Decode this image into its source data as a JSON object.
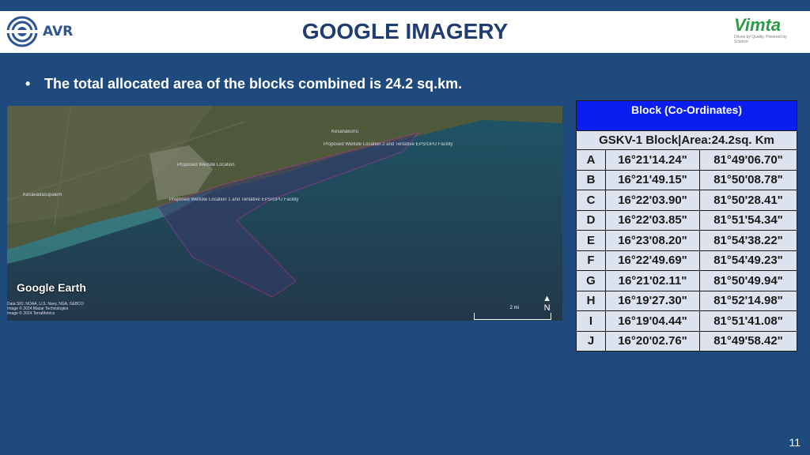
{
  "header": {
    "title": "GOOGLE IMAGERY",
    "left_logo_text": "AVR",
    "right_logo_text": "Vimta",
    "right_logo_tagline": "Drives by Quality, Powered by Science"
  },
  "bullet": {
    "symbol": "•",
    "text": "The total allocated area of the blocks combined is 24.2 sq.km."
  },
  "map": {
    "brand": "Google Earth",
    "scale_label": "2 mi",
    "labels": {
      "location2": "Proposed Wellsite Location 2 and Tentative EPS/GPU Facility",
      "location1": "Proposed Wellsite Location 1 and Tentative EPS/GPU Facility",
      "wellsite": "Proposed Wellsite Location",
      "town1": "Kesavadasupalem",
      "town2": "Kesanakurru"
    },
    "credits": [
      "Data SIO, NOAA, U.S. Navy, NGA, GEBCO",
      "Image © 2024 Maxar Technologies",
      "Image © 2024 TerraMetrics"
    ]
  },
  "table": {
    "header": "Block (Co-Ordinates)",
    "subheader": "GSKV-1 Block|Area:24.2sq. Km",
    "rows": [
      {
        "pt": "A",
        "lat": "16°21'14.24\"",
        "lon": "81°49'06.70\""
      },
      {
        "pt": "B",
        "lat": "16°21'49.15\"",
        "lon": "81°50'08.78\""
      },
      {
        "pt": "C",
        "lat": "16°22'03.90\"",
        "lon": "81°50'28.41\""
      },
      {
        "pt": "D",
        "lat": "16°22'03.85\"",
        "lon": "81°51'54.34\""
      },
      {
        "pt": "E",
        "lat": "16°23'08.20\"",
        "lon": "81°54'38.22\""
      },
      {
        "pt": "F",
        "lat": "16°22'49.69\"",
        "lon": "81°54'49.23\""
      },
      {
        "pt": "G",
        "lat": "16°21'02.11\"",
        "lon": "81°50'49.94\""
      },
      {
        "pt": "H",
        "lat": "16°19'27.30\"",
        "lon": "81°52'14.98\""
      },
      {
        "pt": "I",
        "lat": "16°19'04.44\"",
        "lon": "81°51'41.08\""
      },
      {
        "pt": "J",
        "lat": "16°20'02.76\"",
        "lon": "81°49'58.42\""
      }
    ]
  },
  "page_number": "11"
}
